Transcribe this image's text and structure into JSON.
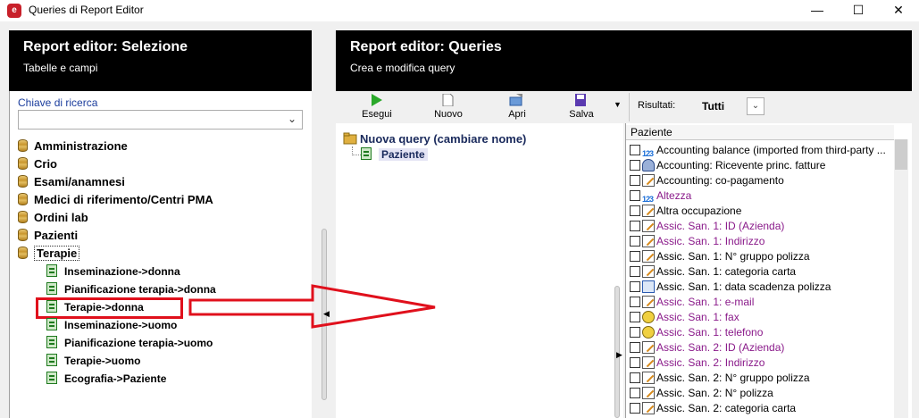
{
  "window": {
    "title": "Queries di Report Editor",
    "minimize_glyph": "—",
    "maximize_glyph": "☐",
    "close_glyph": "✕"
  },
  "left_panel": {
    "title": "Report editor: Selezione",
    "subtitle": "Tabelle e campi",
    "search_label": "Chiave di ricerca",
    "search_value": "",
    "categories": [
      {
        "label": "Amministrazione",
        "icon": "database-icon"
      },
      {
        "label": "Crio",
        "icon": "database-icon"
      },
      {
        "label": "Esami/anamnesi",
        "icon": "database-icon"
      },
      {
        "label": "Medici di riferimento/Centri PMA",
        "icon": "database-icon"
      },
      {
        "label": "Ordini lab",
        "icon": "database-icon"
      },
      {
        "label": "Pazienti",
        "icon": "database-icon"
      },
      {
        "label": "Terapie",
        "icon": "database-icon",
        "expanded": true
      }
    ],
    "terapie_children": [
      {
        "label": "Inseminazione->donna",
        "icon": "table-icon"
      },
      {
        "label": "Pianificazione terapia->donna",
        "icon": "table-icon"
      },
      {
        "label": "Terapie->donna",
        "icon": "table-icon",
        "highlighted": true
      },
      {
        "label": "Inseminazione->uomo",
        "icon": "table-icon"
      },
      {
        "label": "Pianificazione terapia->uomo",
        "icon": "table-icon"
      },
      {
        "label": "Terapie->uomo",
        "icon": "table-icon"
      },
      {
        "label": "Ecografia->Paziente",
        "icon": "table-icon"
      }
    ]
  },
  "right_panel": {
    "title": "Report editor: Queries",
    "subtitle": "Crea e modifica query",
    "toolbar": {
      "execute": "Esegui",
      "new": "Nuovo",
      "open": "Apri",
      "save": "Salva",
      "results_label": "Risultati:",
      "results_value": "Tutti"
    },
    "query_tree": {
      "root": "Nuova query (cambiare nome)",
      "child": "Paziente"
    },
    "fields": {
      "header": "Paziente",
      "items": [
        {
          "label": "Accounting balance (imported from third-party ...",
          "icon": "number-icon",
          "color": "#000000"
        },
        {
          "label": "Accounting: Ricevente princ. fatture",
          "icon": "user-icon",
          "color": "#000000"
        },
        {
          "label": "Accounting: co-pagamento",
          "icon": "text-icon",
          "color": "#000000"
        },
        {
          "label": "Altezza",
          "icon": "number-icon",
          "color": "#8a1a8a"
        },
        {
          "label": "Altra occupazione",
          "icon": "text-icon",
          "color": "#000000"
        },
        {
          "label": "Assic. San. 1: ID (Azienda)",
          "icon": "text-icon",
          "color": "#8a1a8a"
        },
        {
          "label": "Assic. San. 1: Indirizzo",
          "icon": "text-icon",
          "color": "#8a1a8a"
        },
        {
          "label": "Assic. San. 1: N° gruppo polizza",
          "icon": "text-icon",
          "color": "#000000"
        },
        {
          "label": "Assic. San. 1: categoria carta",
          "icon": "text-icon",
          "color": "#000000"
        },
        {
          "label": "Assic. San. 1: data scadenza polizza",
          "icon": "calendar-icon",
          "color": "#000000"
        },
        {
          "label": "Assic. San. 1: e-mail",
          "icon": "text-icon",
          "color": "#8a1a8a"
        },
        {
          "label": "Assic. San. 1: fax",
          "icon": "phone-icon",
          "color": "#8a1a8a"
        },
        {
          "label": "Assic. San. 1: telefono",
          "icon": "phone-icon",
          "color": "#8a1a8a"
        },
        {
          "label": "Assic. San. 2: ID (Azienda)",
          "icon": "text-icon",
          "color": "#8a1a8a"
        },
        {
          "label": "Assic. San. 2: Indirizzo",
          "icon": "text-icon",
          "color": "#8a1a8a"
        },
        {
          "label": "Assic. San. 2: N° gruppo polizza",
          "icon": "text-icon",
          "color": "#000000"
        },
        {
          "label": "Assic. San. 2: N° polizza",
          "icon": "text-icon",
          "color": "#000000"
        },
        {
          "label": "Assic. San. 2: categoria carta",
          "icon": "text-icon",
          "color": "#000000"
        }
      ]
    }
  },
  "colors": {
    "accent_annotation": "#e0101c",
    "header_bg": "#000000",
    "link_blue": "#1a3c9c",
    "purple_field": "#8a1a8a"
  }
}
